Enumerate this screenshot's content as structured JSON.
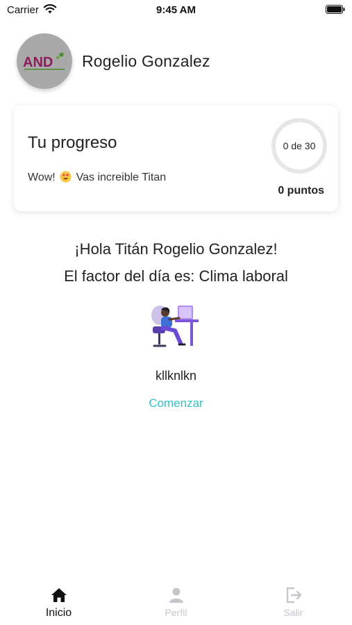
{
  "status_bar": {
    "carrier": "Carrier",
    "time": "9:45 AM"
  },
  "header": {
    "logo_text": "AND",
    "user_name": "Rogelio Gonzalez"
  },
  "progress_card": {
    "title": "Tu progreso",
    "message_before_emoji": "Wow!",
    "message_after_emoji": "Vas increible Titan",
    "emoji": "heart-eyes-emoji",
    "count_text": "0 de 30",
    "completed": 0,
    "total": 30,
    "points_text": "0 puntos"
  },
  "main": {
    "greeting": "¡Hola Titán Rogelio Gonzalez!",
    "factor_line": "El factor del día es: Clima laboral",
    "description": "kllknlkn",
    "start_label": "Comenzar"
  },
  "tab_bar": {
    "tabs": [
      {
        "label": "Inicio",
        "icon": "home-icon",
        "active": true
      },
      {
        "label": "Perfil",
        "icon": "person-icon",
        "active": false
      },
      {
        "label": "Salir",
        "icon": "logout-icon",
        "active": false
      }
    ]
  },
  "colors": {
    "accent_link": "#35c1c6",
    "active_tab": "#111111",
    "inactive_tab": "#c4c6cc",
    "avatar_bg": "#a9a9a9",
    "logo_brand": "#8b1d5c"
  }
}
